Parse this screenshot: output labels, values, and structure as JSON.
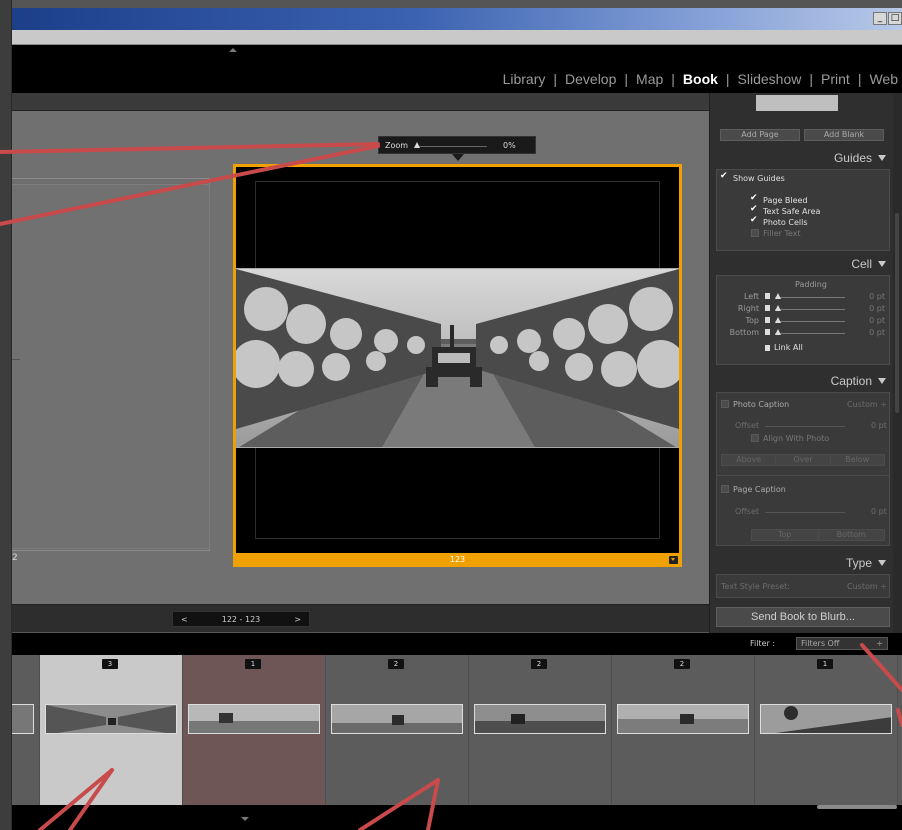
{
  "window": {
    "controls": [
      "_",
      "□"
    ]
  },
  "modules": {
    "items": [
      "Library",
      "Develop",
      "Map",
      "Book",
      "Slideshow",
      "Print",
      "Web"
    ],
    "active": "Book"
  },
  "zoom": {
    "label": "Zoom",
    "value": "0%",
    "level": 0
  },
  "spread": {
    "left_page_number": "2",
    "right_page_number": "123"
  },
  "pager": {
    "prev": "<",
    "range": "122 - 123",
    "next": ">"
  },
  "right_panel": {
    "add_page": "Add Page",
    "add_blank": "Add Blank",
    "guides": {
      "title": "Guides",
      "show_guides": "Show Guides",
      "page_bleed": "Page Bleed",
      "text_safe_area": "Text Safe Area",
      "photo_cells": "Photo Cells",
      "filler_text": "Filler Text"
    },
    "cell": {
      "title": "Cell",
      "padding": "Padding",
      "rows": [
        {
          "label": "Left",
          "value": "0 pt"
        },
        {
          "label": "Right",
          "value": "0 pt"
        },
        {
          "label": "Top",
          "value": "0 pt"
        },
        {
          "label": "Bottom",
          "value": "0 pt"
        }
      ],
      "link_all": "Link All"
    },
    "caption": {
      "title": "Caption",
      "photo_caption": "Photo Caption",
      "custom": "Custom ÷",
      "offset": "Offset",
      "offset_value": "0 pt",
      "align_with_photo": "Align With Photo",
      "positions": [
        "Above",
        "Over",
        "Below"
      ],
      "page_caption": "Page Caption",
      "page_offset": "Offset",
      "page_offset_value": "0 pt",
      "page_positions": [
        "Top",
        "Bottom"
      ]
    },
    "type": {
      "title": "Type",
      "text_style_preset": "Text Style Preset:",
      "custom": "Custom ÷"
    },
    "send_button": "Send Book to Blurb..."
  },
  "filmstrip": {
    "filter_label": "Filter :",
    "filter_value": "Filters Off",
    "cells": [
      {
        "badge": "",
        "state": "partial"
      },
      {
        "badge": "3",
        "state": "selected"
      },
      {
        "badge": "1",
        "state": "used"
      },
      {
        "badge": "2",
        "state": "normal"
      },
      {
        "badge": "2",
        "state": "normal"
      },
      {
        "badge": "2",
        "state": "normal"
      },
      {
        "badge": "1",
        "state": "normal"
      }
    ]
  },
  "colors": {
    "accent": "#f0a100",
    "annotation": "#c94a4a",
    "selected_cell": "#c9c9c9",
    "used_cell": "#6e5656"
  }
}
